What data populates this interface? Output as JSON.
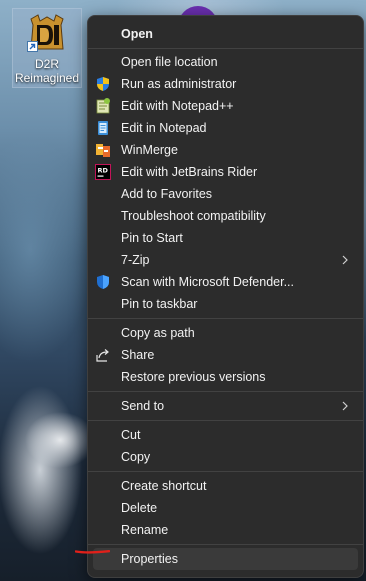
{
  "desktop": {
    "shortcut": {
      "label_line1": "D2R",
      "label_line2": "Reimagined",
      "icon": "d2r-game-icon"
    }
  },
  "menu": {
    "items": [
      {
        "label": "Open",
        "bold": true,
        "icon": ""
      },
      {
        "label": "Open file location",
        "icon": ""
      },
      {
        "label": "Run as administrator",
        "icon": "uac-shield-icon"
      },
      {
        "label": "Edit with Notepad++",
        "icon": "notepad-plus-plus-icon"
      },
      {
        "label": "Edit in Notepad",
        "icon": "notepad-icon"
      },
      {
        "label": "WinMerge",
        "icon": "winmerge-icon"
      },
      {
        "label": "Edit with JetBrains Rider",
        "icon": "rider-icon"
      },
      {
        "label": "Add to Favorites",
        "icon": ""
      },
      {
        "label": "Troubleshoot compatibility",
        "icon": ""
      },
      {
        "label": "Pin to Start",
        "icon": ""
      },
      {
        "label": "7-Zip",
        "icon": "",
        "submenu": true
      },
      {
        "label": "Scan with Microsoft Defender...",
        "icon": "defender-shield-icon"
      },
      {
        "label": "Pin to taskbar",
        "icon": ""
      },
      {
        "label": "Copy as path",
        "icon": ""
      },
      {
        "label": "Share",
        "icon": "share-icon"
      },
      {
        "label": "Restore previous versions",
        "icon": ""
      },
      {
        "label": "Send to",
        "icon": "",
        "submenu": true
      },
      {
        "label": "Cut",
        "icon": ""
      },
      {
        "label": "Copy",
        "icon": ""
      },
      {
        "label": "Create shortcut",
        "icon": ""
      },
      {
        "label": "Delete",
        "icon": ""
      },
      {
        "label": "Rename",
        "icon": ""
      },
      {
        "label": "Properties",
        "icon": "",
        "highlighted": true
      }
    ]
  },
  "colors": {
    "menu_background": "#2c2c2c",
    "menu_text": "#f2f2f2",
    "separator": "#424242",
    "hover": "#3a3a3a",
    "annotation_red": "#e0201a"
  }
}
